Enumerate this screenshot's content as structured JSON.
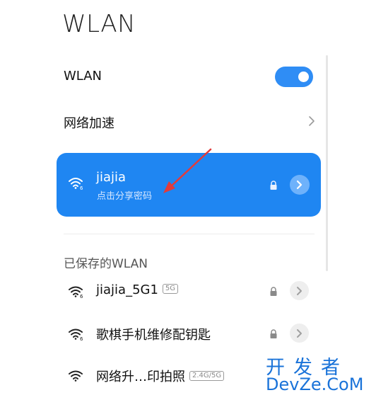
{
  "page": {
    "title": "WLAN"
  },
  "wlan_toggle": {
    "label": "WLAN",
    "state": "on",
    "accent": "#2f8df5"
  },
  "network_accel": {
    "label": "网络加速",
    "icon": "chevron-right-icon"
  },
  "connected_network": {
    "ssid": "jiajia",
    "subtitle": "点击分享密码",
    "card_color": "#1f86f2",
    "icons": [
      "wifi-icon",
      "lock-icon",
      "chevron-right-icon"
    ]
  },
  "saved_section": {
    "title": "已保存的WLAN",
    "items": [
      {
        "ssid": "jiajia_5G1",
        "band": "5G"
      },
      {
        "ssid": "歌棋手机维修配钥匙",
        "band": ""
      },
      {
        "ssid": "网络升…印拍照",
        "band": "2.4G/5G"
      }
    ]
  },
  "watermark": {
    "line1": "开发者",
    "line2": "DevZe",
    "line2_suffix": ".CoM",
    "small": "com"
  }
}
